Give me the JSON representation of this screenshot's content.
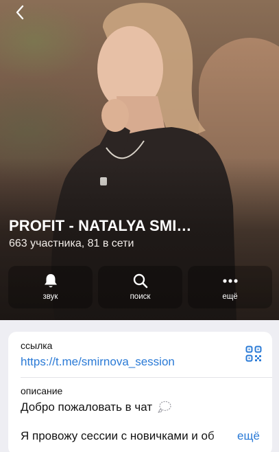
{
  "header": {
    "back_icon": "chevron-left-icon",
    "title": "PROFIT - NATALYA SMI…",
    "subtitle": "663 участника, 81 в сети"
  },
  "actions": [
    {
      "label": "звук",
      "icon": "bell-icon"
    },
    {
      "label": "поиск",
      "icon": "search-icon"
    },
    {
      "label": "ещё",
      "icon": "more-icon"
    }
  ],
  "info": {
    "link_label": "ссылка",
    "link_value": "https://t.me/smirnova_session",
    "qr_icon": "qr-code-icon",
    "description_label": "описание",
    "description_line1": "Добро пожаловать в чат",
    "description_line2": "Я провожу сессии с новичками и об",
    "more_label": "ещё"
  },
  "colors": {
    "accent": "#2a7ad6",
    "card_background": "#ffffff",
    "page_background": "#eeeef3"
  }
}
